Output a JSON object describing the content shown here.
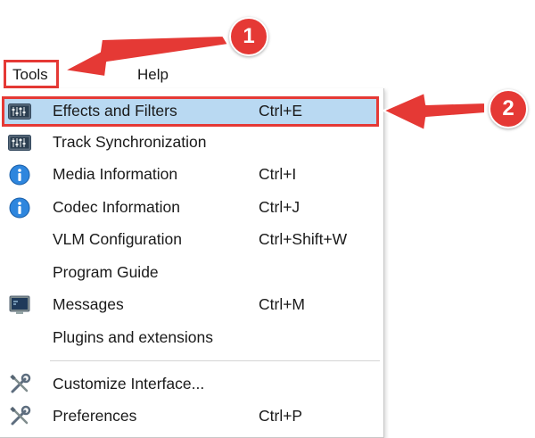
{
  "menubar": {
    "tools_label": "Tools",
    "help_label": "Help"
  },
  "menu": {
    "items": [
      {
        "label": "Effects and Filters",
        "shortcut": "Ctrl+E",
        "icon": "sliders-icon",
        "highlighted": true
      },
      {
        "label": "Track Synchronization",
        "shortcut": "",
        "icon": "sliders-icon"
      },
      {
        "label": "Media Information",
        "shortcut": "Ctrl+I",
        "icon": "info-icon"
      },
      {
        "label": "Codec Information",
        "shortcut": "Ctrl+J",
        "icon": "info-icon"
      },
      {
        "label": "VLM Configuration",
        "shortcut": "Ctrl+Shift+W",
        "icon": ""
      },
      {
        "label": "Program Guide",
        "shortcut": "",
        "icon": ""
      },
      {
        "label": "Messages",
        "shortcut": "Ctrl+M",
        "icon": "messages-icon"
      },
      {
        "label": "Plugins and extensions",
        "shortcut": "",
        "icon": ""
      },
      {
        "label": "Customize Interface...",
        "shortcut": "",
        "icon": "tools-icon"
      },
      {
        "label": "Preferences",
        "shortcut": "Ctrl+P",
        "icon": "tools-icon"
      }
    ]
  },
  "callouts": {
    "step1": "1",
    "step2": "2"
  },
  "colors": {
    "annotation_red": "#e53935",
    "highlight_blue": "#b9d9f2"
  }
}
